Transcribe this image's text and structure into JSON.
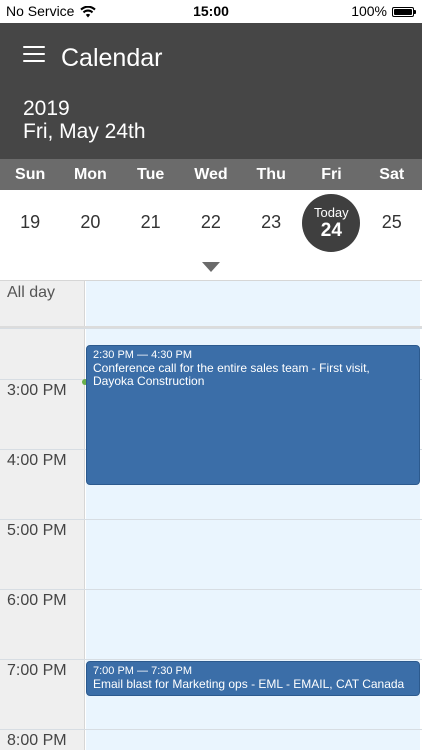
{
  "status_bar": {
    "carrier": "No Service",
    "time": "15:00",
    "battery": "100%"
  },
  "header": {
    "title": "Calendar",
    "year": "2019",
    "date": "Fri, May 24th"
  },
  "week": {
    "days": [
      "Sun",
      "Mon",
      "Tue",
      "Wed",
      "Thu",
      "Fri",
      "Sat"
    ],
    "dates": [
      "19",
      "20",
      "21",
      "22",
      "23",
      "24",
      "25"
    ],
    "today_label": "Today",
    "today_date": "24"
  },
  "allday": {
    "label": "All day"
  },
  "hours": [
    "3:00 PM",
    "4:00 PM",
    "5:00 PM",
    "6:00 PM",
    "7:00 PM",
    "8:00 PM"
  ],
  "events": [
    {
      "time": "2:30 PM — 4:30 PM",
      "title": "Conference call for the entire sales team - First visit, Dayoka Construction"
    },
    {
      "time": "7:00 PM — 7:30 PM",
      "title": "Email blast for Marketing ops - EML - EMAIL, CAT Canada"
    }
  ],
  "colors": {
    "header_bg": "#464646",
    "weekday_bg": "#6b6b6b",
    "event_bg": "#3b6ea8",
    "day_bg": "#eaf5fe"
  }
}
